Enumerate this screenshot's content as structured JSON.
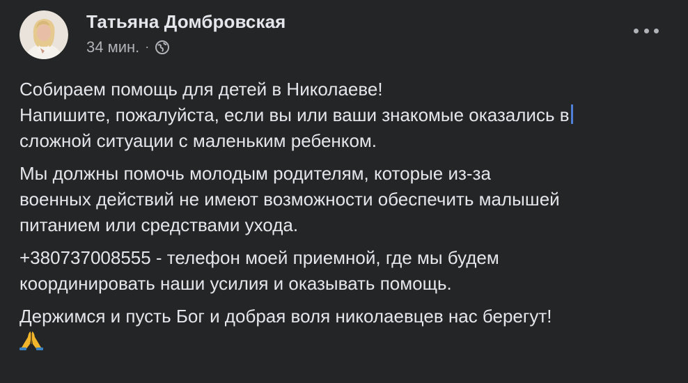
{
  "post": {
    "author": "Татьяна Домбровская",
    "time": "34 мин.",
    "separator": "·",
    "privacy_icon": "globe-icon",
    "more_icon": "more-options-icon",
    "paragraphs": [
      {
        "lines": [
          "Собираем помощь для детей в Николаеве!",
          "Напишите, пожалуйста, если вы или ваши знакомые оказались в",
          "сложной ситуации с маленьким ребенком."
        ]
      },
      {
        "lines": [
          "Мы должны помочь молодым родителям, которые из-за",
          "военных действий не имеют возможности обеспечить малышей",
          "питанием или средствами ухода."
        ]
      },
      {
        "lines": [
          "+380737008555 - телефон моей приемной, где мы будем",
          "координировать наши усилия и оказывать помощь."
        ]
      },
      {
        "lines": [
          "Держимся и пусть Бог и добрая воля николаевцев нас берегут!"
        ],
        "emoji": "folded-hands-icon"
      }
    ]
  },
  "colors": {
    "background": "#242526",
    "text_primary": "#e4e6eb",
    "text_secondary": "#b0b3b8",
    "caret": "#4f7fd6",
    "emoji": "#f2b62c"
  }
}
